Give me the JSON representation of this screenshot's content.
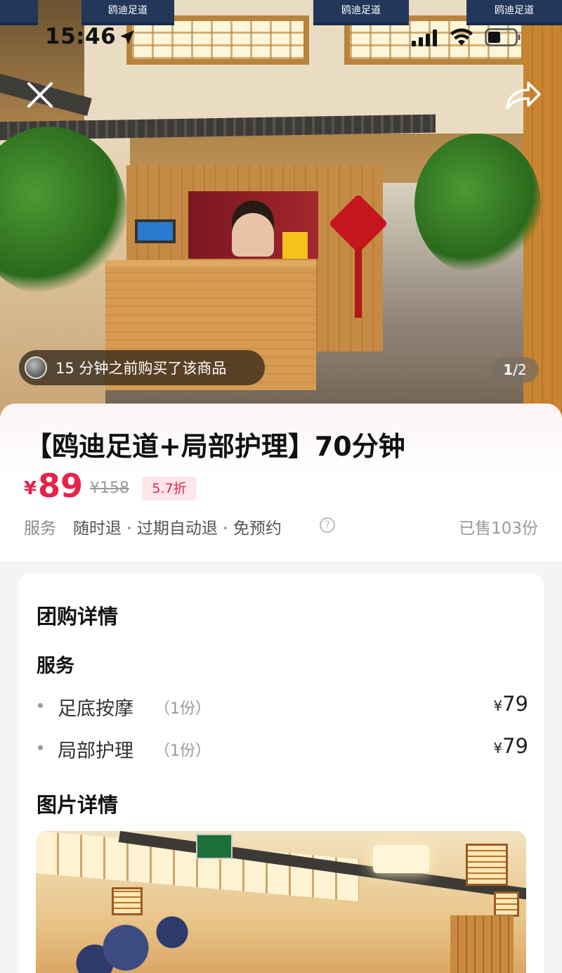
{
  "status_bar": {
    "time": "15:46",
    "icons": [
      "location-arrow-icon",
      "cellular-signal-icon",
      "wifi-icon",
      "battery-icon"
    ]
  },
  "hero": {
    "banners": [
      "鸥迪足道",
      "鸥迪足道",
      "鸥迪足道"
    ],
    "top_icons": [
      "close-icon",
      "share-icon"
    ],
    "buyer_toast": "15 分钟之前购买了该商品",
    "page_current": "1",
    "page_total": "/2"
  },
  "product": {
    "title": "【鸥迪足道+局部护理】70分钟",
    "price_symbol": "¥",
    "price": "89",
    "original_price": "¥158",
    "discount": "5.7折",
    "service_label": "服务",
    "service_terms": "随时退 · 过期自动退 · 免预约",
    "help_glyph": "?",
    "sold": "已售103份"
  },
  "detail": {
    "heading": "团购详情",
    "service_heading": "服务",
    "items": [
      {
        "name": "足底按摩",
        "qty": "（1份）",
        "yen": "¥",
        "price": "79"
      },
      {
        "name": "局部护理",
        "qty": "（1份）",
        "yen": "¥",
        "price": "79"
      }
    ],
    "photo_heading": "图片详情"
  },
  "colors": {
    "accent_price": "#e4244a",
    "discount_bg": "#fde6ea",
    "page_bg": "#f4f4f6"
  }
}
